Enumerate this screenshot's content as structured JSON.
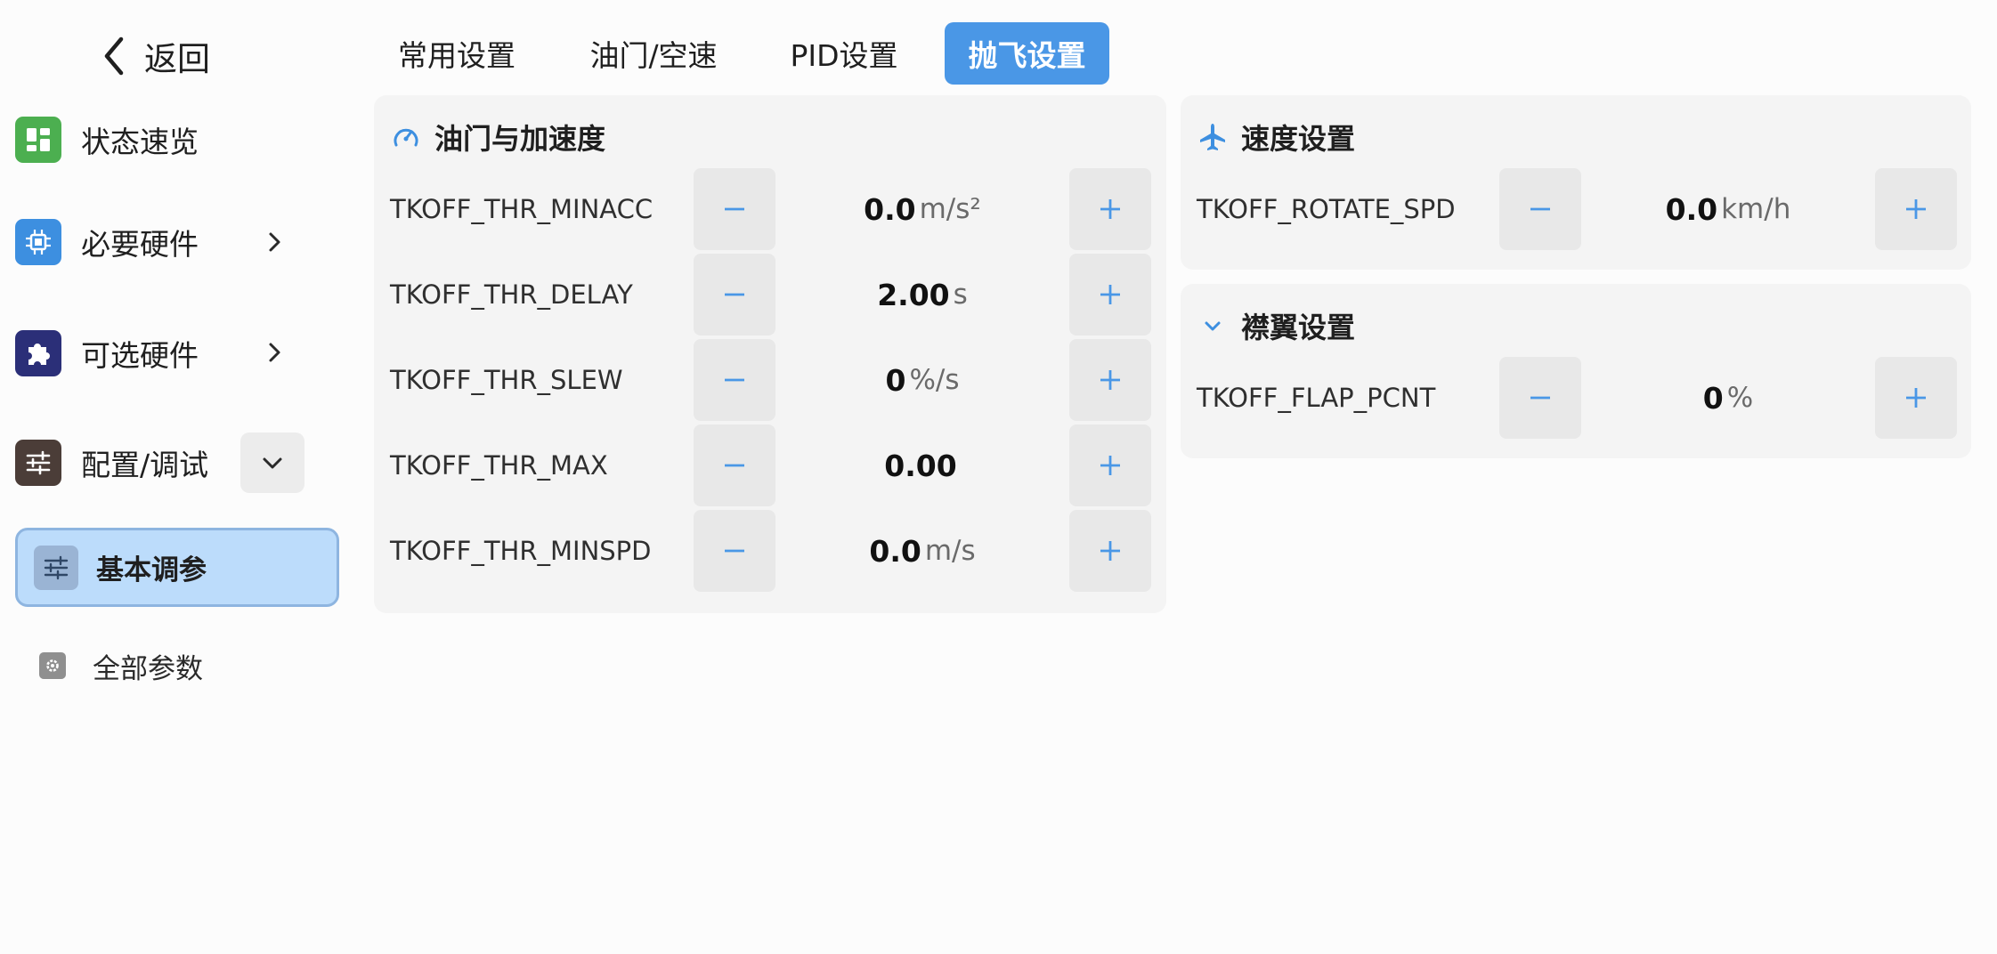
{
  "sidebar": {
    "back_label": "返回",
    "items": [
      {
        "label": "状态速览",
        "icon": "dashboard-icon",
        "color": "#4caf50"
      },
      {
        "label": "必要硬件",
        "icon": "chip-icon",
        "color": "#3d8fe0"
      },
      {
        "label": "可选硬件",
        "icon": "puzzle-icon",
        "color": "#2b2f78"
      },
      {
        "label": "配置/调试",
        "icon": "sliders-icon",
        "color": "#4b3d38"
      }
    ],
    "sub_items": [
      {
        "label": "基本调参",
        "icon": "tune-icon",
        "active": true
      },
      {
        "label": "全部参数",
        "icon": "gear-icon",
        "active": false
      }
    ]
  },
  "tabs": [
    {
      "label": "常用设置",
      "active": false
    },
    {
      "label": "油门/空速",
      "active": false
    },
    {
      "label": "PID设置",
      "active": false
    },
    {
      "label": "抛飞设置",
      "active": true
    }
  ],
  "panels": {
    "throttle": {
      "title": "油门与加速度",
      "icon": "speedometer-icon",
      "rows": [
        {
          "name": "TKOFF_THR_MINACC",
          "value": "0.0",
          "unit": "m/s²"
        },
        {
          "name": "TKOFF_THR_DELAY",
          "value": "2.00",
          "unit": "s"
        },
        {
          "name": "TKOFF_THR_SLEW",
          "value": "0",
          "unit": "%/s"
        },
        {
          "name": "TKOFF_THR_MAX",
          "value": "0.00",
          "unit": ""
        },
        {
          "name": "TKOFF_THR_MINSPD",
          "value": "0.0",
          "unit": "m/s"
        }
      ]
    },
    "speed": {
      "title": "速度设置",
      "icon": "airplane-icon",
      "rows": [
        {
          "name": "TKOFF_ROTATE_SPD",
          "value": "0.0",
          "unit": "km/h"
        }
      ]
    },
    "flap": {
      "title": "襟翼设置",
      "icon": "chevron-down-icon",
      "rows": [
        {
          "name": "TKOFF_FLAP_PCNT",
          "value": "0",
          "unit": "%"
        }
      ]
    }
  },
  "colors": {
    "accent": "#4a97e6",
    "active_bg": "#bcdcfb",
    "panel_bg": "#f4f4f4",
    "button_bg": "#e8e8e8"
  }
}
